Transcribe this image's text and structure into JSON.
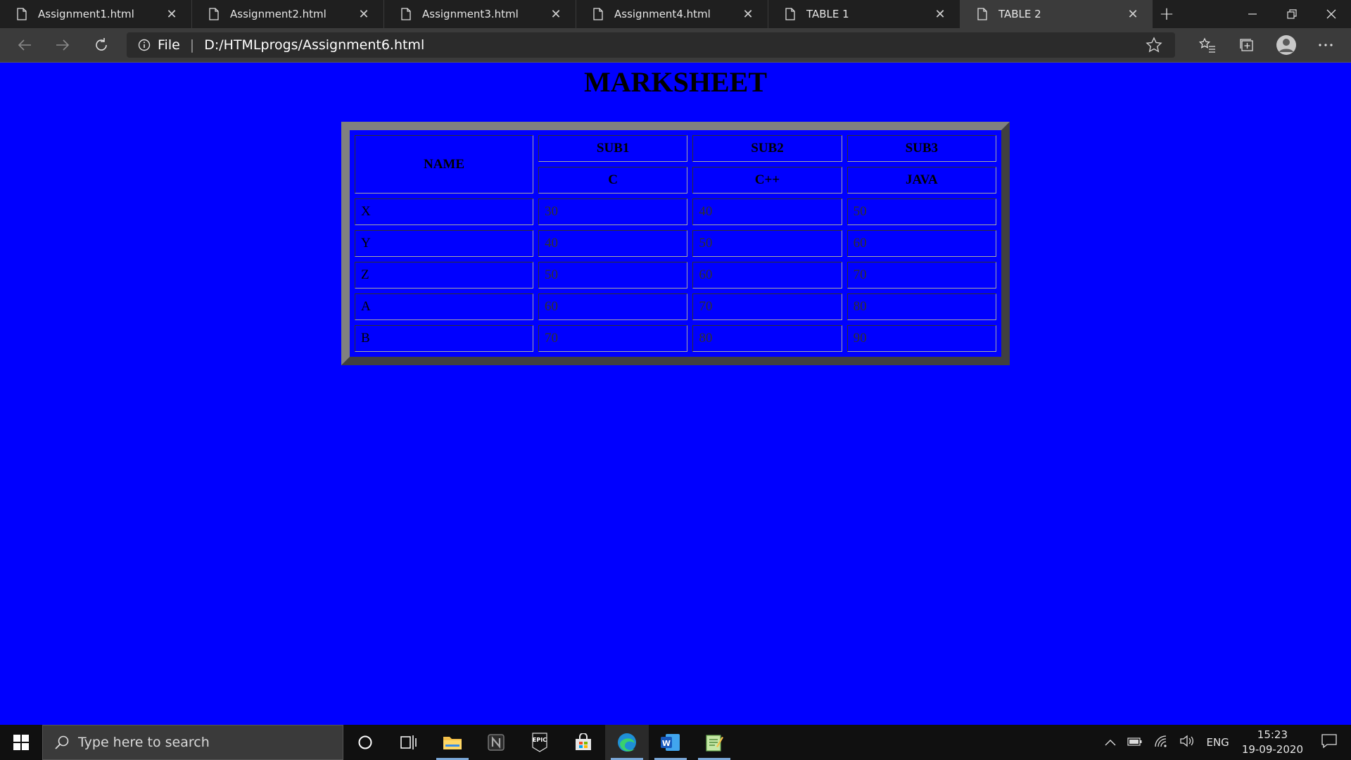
{
  "browser": {
    "tabs": [
      {
        "label": "Assignment1.html",
        "active": false
      },
      {
        "label": "Assignment2.html",
        "active": false
      },
      {
        "label": "Assignment3.html",
        "active": false
      },
      {
        "label": "Assignment4.html",
        "active": false
      },
      {
        "label": "TABLE 1",
        "active": false
      },
      {
        "label": "TABLE 2",
        "active": true
      }
    ],
    "address": {
      "scheme_label": "File",
      "url": "D:/HTMLprogs/Assignment6.html"
    }
  },
  "page": {
    "background_color": "#0000ff",
    "title": "MARKSHEET",
    "table": {
      "name_header": "NAME",
      "subjects": [
        {
          "code": "SUB1",
          "name": "C"
        },
        {
          "code": "SUB2",
          "name": "C++"
        },
        {
          "code": "SUB3",
          "name": "JAVA"
        }
      ],
      "rows": [
        {
          "name": "X",
          "marks": [
            "30",
            "40",
            "50"
          ]
        },
        {
          "name": "Y",
          "marks": [
            "40",
            "50",
            "60"
          ]
        },
        {
          "name": "Z",
          "marks": [
            "50",
            "60",
            "70"
          ]
        },
        {
          "name": "A",
          "marks": [
            "60",
            "70",
            "80"
          ]
        },
        {
          "name": "B",
          "marks": [
            "70",
            "80",
            "90"
          ]
        }
      ]
    }
  },
  "taskbar": {
    "search_placeholder": "Type here to search",
    "language": "ENG",
    "time": "15:23",
    "date": "19-09-2020",
    "apps": [
      "cortana-icon",
      "task-view-icon",
      "file-explorer-icon",
      "notion-icon",
      "epic-games-icon",
      "store-icon",
      "edge-icon",
      "word-icon",
      "notepad-icon"
    ]
  }
}
